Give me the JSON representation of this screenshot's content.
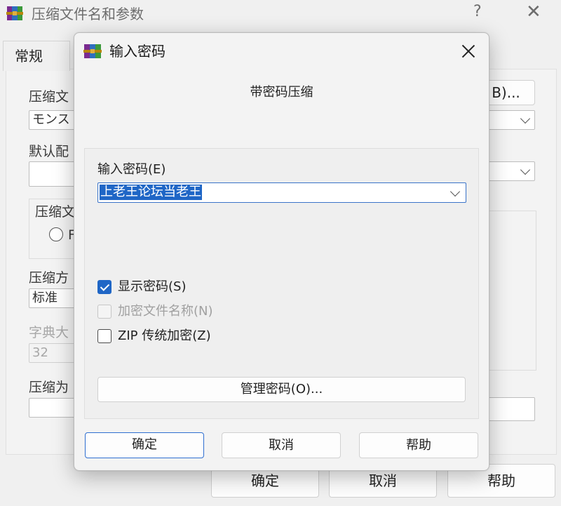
{
  "background_window": {
    "title": "压缩文件名和参数",
    "help_label": "?",
    "close_label": "✕",
    "tab_general": "常规",
    "archive_name_label": "压缩文",
    "archive_name_value": "モンス",
    "browse_button_partial": "B)...",
    "default_profile_label": "默认配",
    "archive_format_label": "压缩文",
    "radio_partial": "F",
    "method_label": "压缩方",
    "method_value": "标准",
    "dict_size_label": "字典大",
    "dict_size_value": "32",
    "split_label": "压缩为",
    "ok_label": "确定",
    "cancel_label": "取消",
    "help_button_label": "帮助"
  },
  "dialog": {
    "title": "输入密码",
    "heading": "带密码压缩",
    "password_label": "输入密码(E)",
    "password_value": "上老王论坛当老王",
    "checkboxes": [
      {
        "label": "显示密码(S)",
        "checked": true,
        "enabled": true
      },
      {
        "label": "加密文件名称(N)",
        "checked": false,
        "enabled": false
      },
      {
        "label": "ZIP 传统加密(Z)",
        "checked": false,
        "enabled": true
      }
    ],
    "manage_button": "管理密码(O)...",
    "ok_button": "确定",
    "cancel_button": "取消",
    "help_button": "帮助"
  },
  "colors": {
    "accent": "#1f66c6",
    "focus_border": "#2f6fd0"
  },
  "icons": [
    "winrar-icon",
    "close-icon",
    "help-icon",
    "chevron-down-icon",
    "checkmark-icon"
  ]
}
